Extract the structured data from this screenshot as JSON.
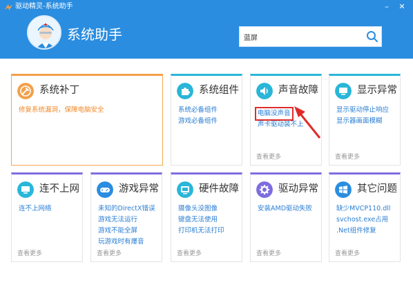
{
  "window": {
    "title": "驱动精灵-系统助手",
    "minimize": "–",
    "close": "✕"
  },
  "header": {
    "app_title": "系统助手",
    "search": {
      "value": "蓝屏",
      "icon": "search-icon"
    },
    "colors": {
      "header_bg": "#2a8de0"
    }
  },
  "cards": {
    "patch": {
      "title": "系统补丁",
      "icon": "wrench-icon",
      "links": [
        "修复系统漏洞，保障电脑安全"
      ]
    },
    "components": {
      "title": "系统组件",
      "icon": "puzzle-icon",
      "links": [
        "系统必备组件",
        "游戏必备组件"
      ]
    },
    "sound": {
      "title": "声音故障",
      "icon": "speaker-icon",
      "links": [
        "电脑没声音",
        "声卡驱动装不上"
      ],
      "more": "查看更多"
    },
    "display": {
      "title": "显示异常",
      "icon": "monitor-icon",
      "links": [
        "显示驱动停止响应",
        "显示器画面模糊"
      ],
      "more": "查看更多"
    },
    "network": {
      "title": "连不上网",
      "icon": "network-monitor-icon",
      "links": [
        "连不上网络"
      ],
      "more": "查看更多"
    },
    "game": {
      "title": "游戏异常",
      "icon": "gamepad-icon",
      "links": [
        "未知的DirectX错误",
        "游戏无法运行",
        "游戏不能全屏",
        "玩游戏时有爆音"
      ],
      "more": "查看更多"
    },
    "hardware": {
      "title": "硬件故障",
      "icon": "hardware-icon",
      "links": [
        "摄像头没图像",
        "键盘无法使用",
        "打印机无法打印"
      ],
      "more": "查看更多"
    },
    "driver": {
      "title": "驱动异常",
      "icon": "gear-icon",
      "links": [
        "安装AMD驱动失败"
      ],
      "more": "查看更多"
    },
    "other": {
      "title": "其它问题",
      "icon": "windows-icon",
      "links": [
        "缺少MVCP110.dll",
        "svchost.exe占用",
        ".Net组件修复"
      ],
      "more": "查看更多"
    }
  },
  "colors": {
    "accent_cyan": "#29b6d8",
    "accent_orange": "#f2a04a",
    "accent_purple": "#7d6de0",
    "link_blue": "#2a7ed2",
    "highlight_red": "#e02a2a"
  }
}
